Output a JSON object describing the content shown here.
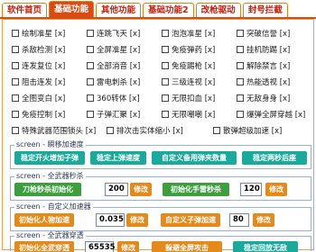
{
  "tabs": [
    {
      "label": "软件首页"
    },
    {
      "label": "基础功能",
      "active": true
    },
    {
      "label": "其他功能"
    },
    {
      "label": "基础功能2"
    },
    {
      "label": "改枪驱动"
    },
    {
      "label": "封号拦截"
    }
  ],
  "checkboxes": [
    [
      "绘制准星 [x]",
      "连跳飞天 [x]",
      "泡泡准星 [x]",
      "突破信誉 [x]"
    ],
    [
      "杀敌检测 [x]",
      "全屏准星 [x]",
      "免疫弹药 [x]",
      "挂机防踢 [x]"
    ],
    [
      "连发复位 [x]",
      "全部消音 [x]",
      "免疫踢枪 [x]",
      "解除禁言 [x]"
    ],
    [
      "阻击连发 [x]",
      "雷电刺杀 [x]",
      "三级连视 [x]",
      "热能透视 [x]"
    ],
    [
      "全图变白 [x]",
      "360转体 [x]",
      "无限扣血 [x]",
      "无敌身身 [x]"
    ],
    [
      "免疫控制 [x]",
      "子弹汇聚 [x]",
      "无限嘲嘲 [x]",
      "爆弹全屏穿越 [x]"
    ],
    [
      "特殊武器范围锁头 [x]",
      "排次击实体缩小 [x]",
      "散弹超级加速 [x]"
    ]
  ],
  "groups": {
    "g1": {
      "title": "screen - 瞬移加速度",
      "buttons": [
        "稳定开火增加子弹",
        "稳定上弹速度",
        "自定义备用弹夹数量",
        "稳定两秒后座"
      ]
    },
    "g2": {
      "title": "screen - 全武器秒杀",
      "button_a": "刀枪秒杀初始化",
      "value_a": "200",
      "modify": "修改",
      "button_b": "初始化手雷秒杀",
      "value_b": "120",
      "modify_b": "修改"
    },
    "g3": {
      "title": "screen - 自定义加速器",
      "button_a": "初始化人物加速",
      "value_a": "0.035",
      "modify": "修改",
      "button_b": "自定义子弹加速",
      "value_b": "80",
      "modify_b": "修改"
    },
    "g4": {
      "title": "screen - 全武器穿透",
      "button_a": "初始化全武穿透",
      "value_a": "65535",
      "modify": "修改",
      "button_b": "躲避全屏攻击",
      "button_c": "稳定回放无敌"
    }
  }
}
